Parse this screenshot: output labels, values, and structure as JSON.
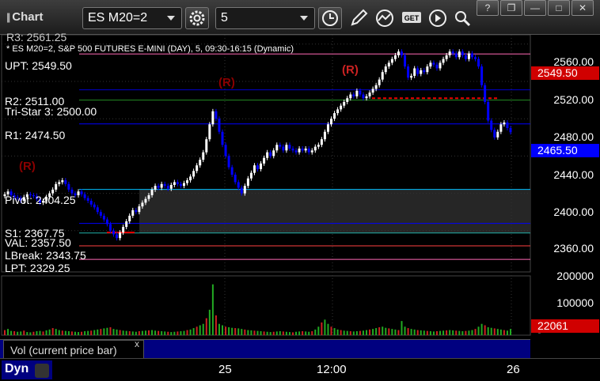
{
  "toolbar": {
    "app_title": "Chart",
    "symbol": "ES M20=2",
    "interval": "5",
    "icons": [
      "settings-gear-icon",
      "clock-icon",
      "pencil-icon",
      "indicator-icon",
      "get-icon",
      "play-icon",
      "search-icon"
    ],
    "window_buttons": [
      "?",
      "❐",
      "—",
      "□",
      "✕"
    ]
  },
  "chart": {
    "info_line": "* ES M20=2, S&P 500 FUTURES E-MINI (DAY), 5, 09:30-16:15 (Dynamic)",
    "top_partial": "R3: 2561.25",
    "levels": [
      {
        "label": "UPT: 2549.50",
        "price": 2549.5,
        "color": "#ff69b4"
      },
      {
        "label": "R2: 2511.00",
        "price": 2511.0,
        "color": "#0000cd"
      },
      {
        "label": "Tri-Star 3: 2500.00",
        "price": 2500.0,
        "color": "#228b22"
      },
      {
        "label": "R1: 2474.50",
        "price": 2474.5,
        "color": "#0000ff"
      },
      {
        "label": "Pivot: 2404.25",
        "price": 2404.25,
        "color": "#00bfff"
      },
      {
        "label": "S1: 2367.75",
        "price": 2367.75,
        "color": "#0000ff"
      },
      {
        "label": "VAL: 2357.50",
        "price": 2357.5,
        "color": "#20b2aa"
      },
      {
        "label": "LBreak: 2343.75",
        "price": 2343.75,
        "color": "#ff4040"
      },
      {
        "label": "LPT: 2329.25",
        "price": 2329.25,
        "color": "#ff69b4"
      }
    ],
    "price_ticks": [
      "2560.00",
      "2520.00",
      "2480.00",
      "2440.00",
      "2400.00",
      "2360.00"
    ],
    "price_tag_upt": "2549.50",
    "price_tag_last": "2465.50",
    "r_marks": [
      "(R)",
      "(R)",
      "(R)"
    ],
    "volume_ticks": [
      "200000",
      "100000",
      "0"
    ],
    "volume_tag": "22061",
    "colors": {
      "up": "#ffffff",
      "down": "#0000ff",
      "td_setup": "#00aa00",
      "td_count": "#ff00ff"
    }
  },
  "chart_data": {
    "type": "candlestick",
    "ylim": [
      2320,
      2570
    ],
    "volume_ylim": [
      0,
      210000
    ],
    "x_tick_labels": [
      "25",
      "12:00",
      "26"
    ],
    "closes": [
      2399,
      2402,
      2398,
      2396,
      2395,
      2392,
      2396,
      2399,
      2398,
      2397,
      2394,
      2390,
      2392,
      2396,
      2400,
      2404,
      2410,
      2412,
      2414,
      2410,
      2404,
      2400,
      2398,
      2402,
      2399,
      2395,
      2392,
      2388,
      2385,
      2380,
      2376,
      2372,
      2367,
      2360,
      2356,
      2352,
      2358,
      2364,
      2370,
      2376,
      2382,
      2380,
      2386,
      2390,
      2394,
      2398,
      2404,
      2408,
      2406,
      2410,
      2408,
      2405,
      2409,
      2412,
      2410,
      2408,
      2411,
      2414,
      2418,
      2424,
      2430,
      2436,
      2444,
      2458,
      2474,
      2488,
      2480,
      2466,
      2452,
      2440,
      2428,
      2420,
      2412,
      2406,
      2400,
      2408,
      2416,
      2422,
      2430,
      2426,
      2432,
      2438,
      2444,
      2440,
      2446,
      2452,
      2450,
      2446,
      2452,
      2448,
      2446,
      2444,
      2448,
      2446,
      2448,
      2444,
      2446,
      2450,
      2452,
      2458,
      2466,
      2474,
      2480,
      2486,
      2490,
      2494,
      2498,
      2502,
      2506,
      2504,
      2510,
      2506,
      2502,
      2504,
      2508,
      2512,
      2516,
      2522,
      2530,
      2536,
      2540,
      2544,
      2548,
      2552,
      2548,
      2536,
      2524,
      2526,
      2534,
      2528,
      2532,
      2530,
      2536,
      2540,
      2538,
      2534,
      2540,
      2544,
      2548,
      2552,
      2550,
      2546,
      2552,
      2548,
      2544,
      2550,
      2546,
      2544,
      2536,
      2516,
      2498,
      2478,
      2468,
      2460,
      2466,
      2474,
      2476,
      2470,
      2465.5
    ],
    "volumes": [
      18000,
      22000,
      15000,
      14000,
      12000,
      13000,
      16000,
      11000,
      10000,
      12000,
      14000,
      15000,
      13000,
      17000,
      20000,
      25000,
      22000,
      18000,
      16000,
      15000,
      14000,
      13000,
      12000,
      11000,
      12000,
      14000,
      15000,
      16000,
      18000,
      20000,
      22000,
      24000,
      26000,
      28000,
      22000,
      20000,
      18000,
      16000,
      15000,
      14000,
      13000,
      12000,
      14000,
      15000,
      16000,
      17000,
      18000,
      16000,
      15000,
      14000,
      13000,
      12000,
      11000,
      12000,
      13000,
      14000,
      15000,
      18000,
      20000,
      25000,
      30000,
      35000,
      40000,
      60000,
      90000,
      180000,
      70000,
      40000,
      35000,
      30000,
      28000,
      26000,
      25000,
      24000,
      22000,
      20000,
      18000,
      17000,
      16000,
      15000,
      14000,
      13000,
      12000,
      11000,
      12000,
      13000,
      14000,
      13000,
      12000,
      11000,
      10000,
      12000,
      13000,
      14000,
      13000,
      12000,
      14000,
      20000,
      30000,
      45000,
      55000,
      40000,
      30000,
      25000,
      20000,
      18000,
      16000,
      15000,
      14000,
      13000,
      14000,
      15000,
      16000,
      18000,
      20000,
      22000,
      25000,
      28000,
      30000,
      26000,
      24000,
      22000,
      20000,
      18000,
      50000,
      30000,
      25000,
      22000,
      20000,
      18000,
      17000,
      16000,
      15000,
      14000,
      13000,
      14000,
      15000,
      16000,
      17000,
      18000,
      17000,
      16000,
      15000,
      14000,
      15000,
      16000,
      18000,
      22000,
      30000,
      40000,
      35000,
      28000,
      26000,
      24000,
      22000,
      20000,
      18000,
      16000,
      22061
    ]
  },
  "bottom": {
    "vol_tab_label": "Vol (current price bar)",
    "vol_close": "x",
    "dyn_label": "Dyn"
  }
}
